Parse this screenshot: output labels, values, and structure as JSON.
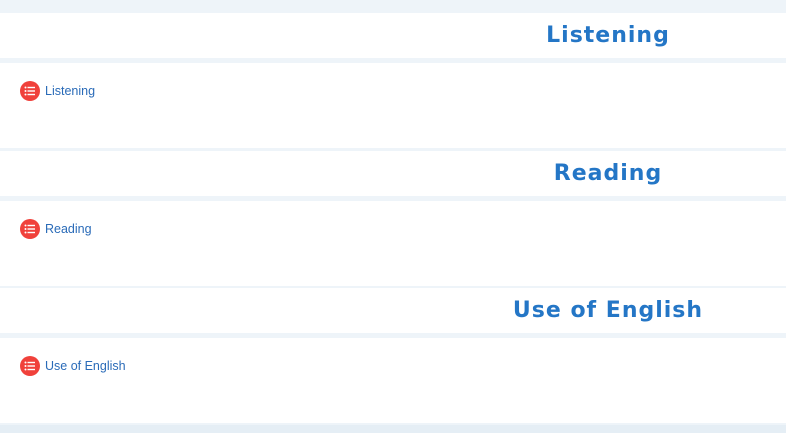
{
  "sections": [
    {
      "title": "Listening",
      "activity": {
        "label": "Listening",
        "icon": "list-icon"
      }
    },
    {
      "title": "Reading",
      "activity": {
        "label": "Reading",
        "icon": "list-icon"
      }
    },
    {
      "title": "Use of English",
      "activity": {
        "label": "Use of English",
        "icon": "list-icon"
      }
    }
  ],
  "colors": {
    "title": "#2476c6",
    "link": "#2a6bb8",
    "icon_bg": "#f0413b",
    "background": "#eef4f9"
  }
}
